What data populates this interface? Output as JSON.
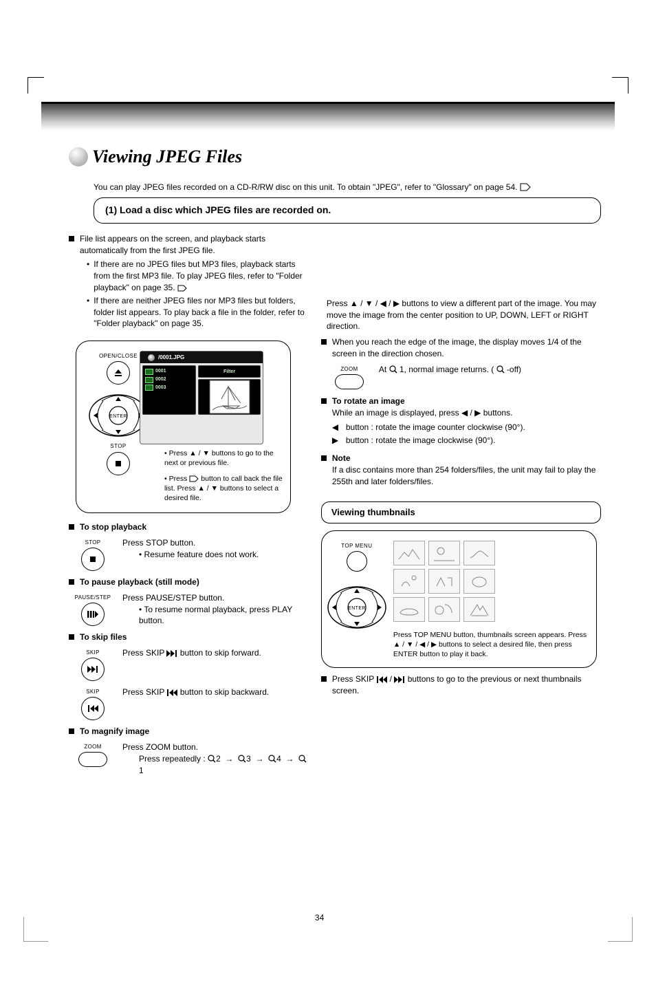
{
  "title": "Viewing JPEG Files",
  "intro": "You can play JPEG files recorded on a CD-R/RW disc on this unit. To obtain \"JPEG\", refer to \"Glossary\" on page 54.",
  "callout": "(1) Load a disc which JPEG files are recorded on.",
  "left": {
    "block1": {
      "heading": "File list appears on the screen, and playback starts automatically from the first JPEG file.",
      "sub": [
        "If there are no JPEG files but MP3 files, playback starts from the first MP3 file. To play JPEG files, refer to \"Folder playback\" on page 35.",
        "If there are neither JPEG files nor MP3 files but folders, folder list appears. To play back a file in the folder, refer to \"Folder playback\" on page 35."
      ]
    },
    "panel": {
      "open_close_label": "OPEN/CLOSE",
      "stop_label": "STOP",
      "screen_title": "/0001.JPG",
      "files": [
        "0001",
        "0002",
        "0003"
      ],
      "filter_label": "Filter",
      "caption1_a": "Press ",
      "caption1_b": " buttons to go to the next or previous file.",
      "caption2_a": "Press ",
      "caption2_b": " button to call back the file list. Press ",
      "caption2_c": " buttons to select a desired file."
    },
    "block_stop": {
      "heading": "To stop playback",
      "label": "STOP",
      "text": "Press STOP button.",
      "note": "Resume feature does not work."
    },
    "block_pause": {
      "heading": "To pause playback (still mode)",
      "label": "PAUSE/STEP",
      "text": "Press PAUSE/STEP button.",
      "note": "To resume normal playback, press PLAY button."
    },
    "block_skip": {
      "heading": "To skip files",
      "label1": "SKIP",
      "text1a": "Press SKIP ",
      "text1b": " button to skip forward.",
      "label2": "SKIP",
      "text2a": "Press SKIP ",
      "text2b": " button to skip backward."
    },
    "block_zoom": {
      "heading": "To magnify image",
      "label": "ZOOM",
      "text": "Press ZOOM button.",
      "seq_prefix": "Press repeatedly : ",
      "seq": [
        "2",
        "3",
        "4",
        "1"
      ]
    }
  },
  "right": {
    "block_scroll": {
      "text_a": "Press ",
      "text_b": " buttons to view a different part of the image. You may move the image from the center position to UP, DOWN, LEFT or RIGHT direction."
    },
    "block_zoom_r": {
      "heading": "When you reach the edge of the image, the display moves 1/4 of the screen in the direction chosen.",
      "label": "ZOOM",
      "text_a": "At ",
      "text_b": "1, normal image returns. (",
      "text_c": "-off)"
    },
    "block_rotate": {
      "heading": "To rotate an image",
      "text_a": "While an image is displayed, press ",
      "text_b": " buttons.",
      "sub": [
        "button : rotate the image counter clockwise (90°).",
        "button : rotate the image clockwise (90°)."
      ]
    },
    "block_note": {
      "heading": "Note",
      "text": "If a disc contains more than 254 folders/files, the unit may fail to play the 255th and later folders/files."
    },
    "subhead": "Viewing thumbnails",
    "thumb_panel": {
      "top_menu_label": "TOP MENU",
      "caption_a": "Press TOP MENU button, thumbnails screen appears. Press ",
      "caption_b": " buttons to select a desired file, then press ENTER button to play it back."
    },
    "block_thumb_skip": {
      "text_a": "Press SKIP ",
      "text_b": " buttons to go to the previous or next thumbnails screen."
    }
  },
  "tag_glyph": "⌂",
  "mag_glyph": "🔍",
  "page_number": "34"
}
